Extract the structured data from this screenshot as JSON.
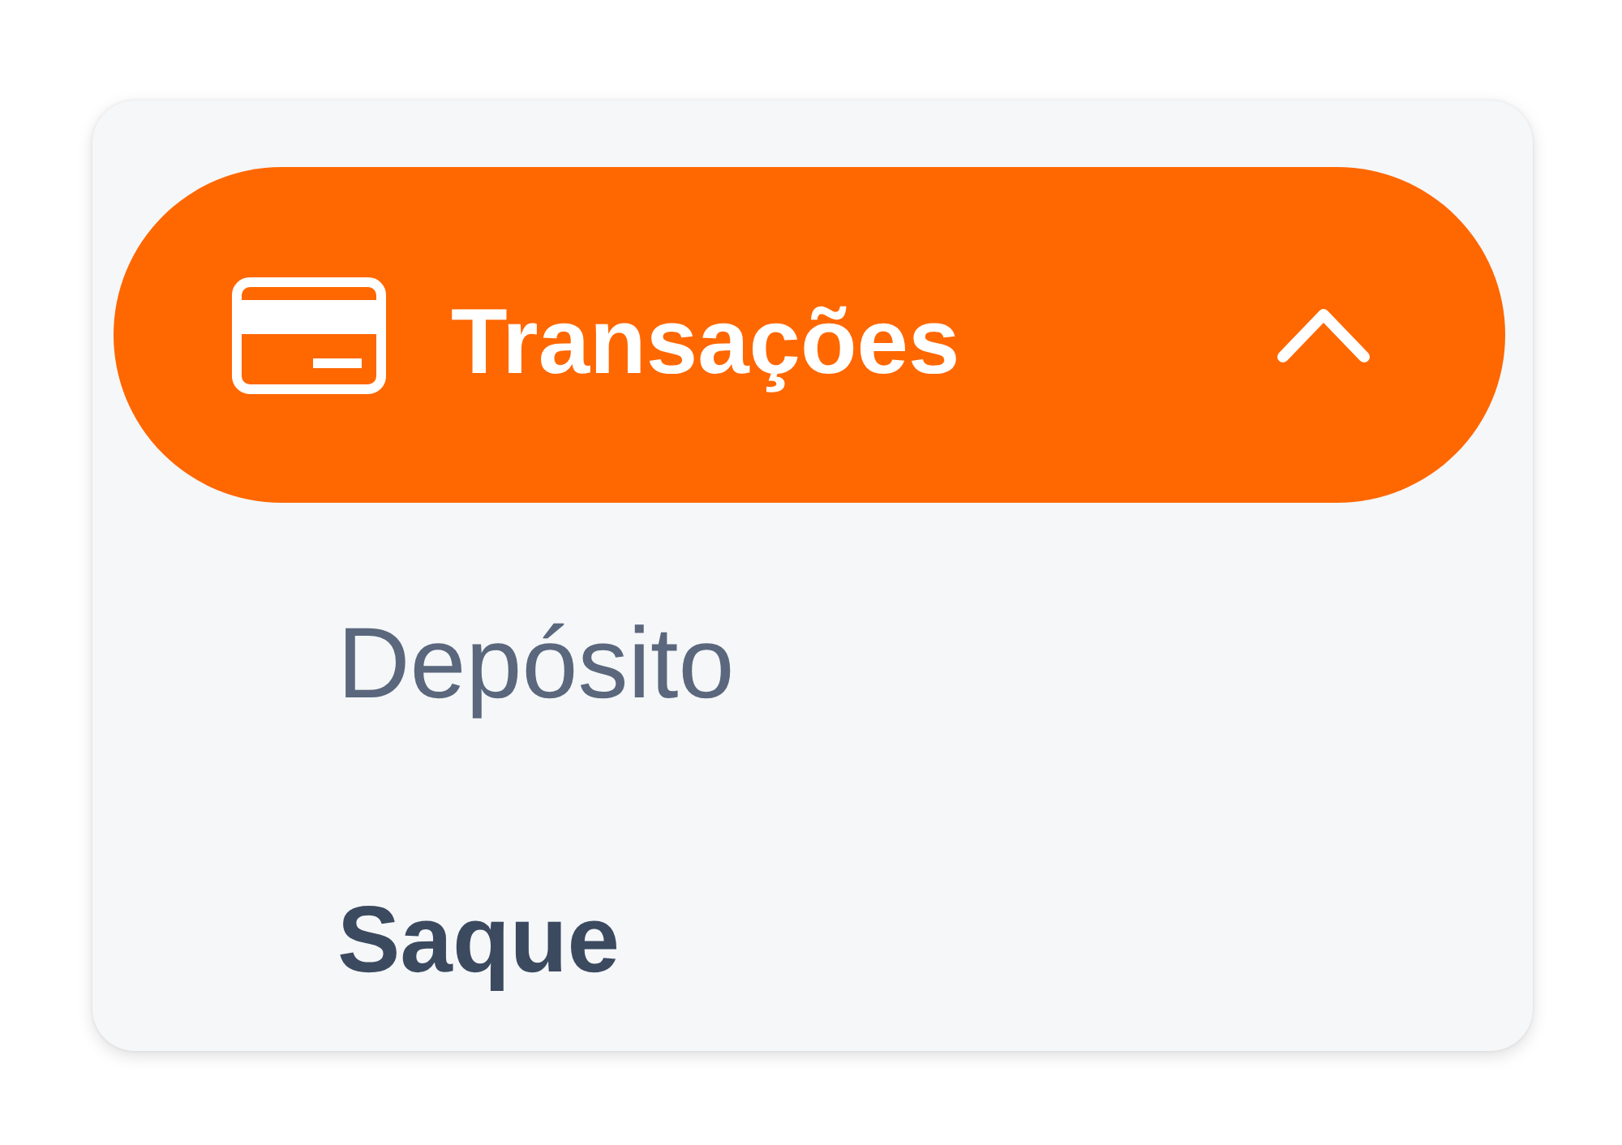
{
  "menu": {
    "items": [
      {
        "label": "Transações",
        "selected": true,
        "expanded": true,
        "children": [
          {
            "label": "Depósito",
            "selected": false
          },
          {
            "label": "Saque",
            "selected": true
          }
        ]
      }
    ]
  }
}
